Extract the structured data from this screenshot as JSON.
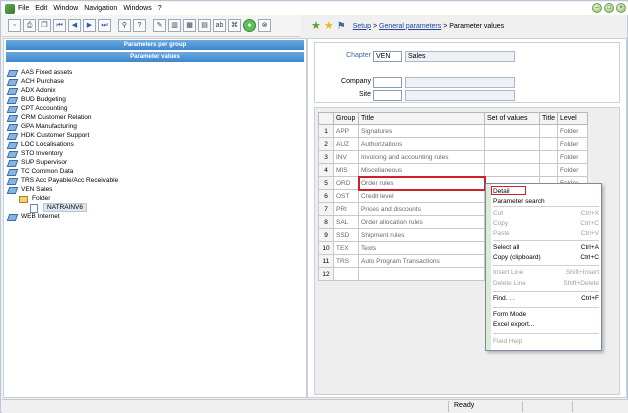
{
  "menubar": {
    "items": [
      "File",
      "Edit",
      "Window",
      "Navigation",
      "Windows",
      "?"
    ]
  },
  "toolbar": {
    "buttons": [
      "new-icon",
      "print-icon",
      "copy-icon",
      "first-icon",
      "prev-icon",
      "next-icon",
      "last-icon",
      "link-icon",
      "help-icon",
      "tree-icon",
      "split-icon",
      "grid-icon",
      "text-icon",
      "tool-icon",
      "go-icon",
      "stop-icon"
    ],
    "ab_label": "ab"
  },
  "left": {
    "header_group": "Parameters per group",
    "header_values": "Parameter values",
    "tree": [
      {
        "label": "AAS Fixed assets",
        "level": 0
      },
      {
        "label": "ACH Purchase",
        "level": 0
      },
      {
        "label": "ADX Adonix",
        "level": 0
      },
      {
        "label": "BUD Budgeting",
        "level": 0
      },
      {
        "label": "CPT Accounting",
        "level": 0
      },
      {
        "label": "CRM Customer Relation",
        "level": 0
      },
      {
        "label": "GPA Manufacturing",
        "level": 0
      },
      {
        "label": "HDK Customer Support",
        "level": 0
      },
      {
        "label": "LOC Localisations",
        "level": 0
      },
      {
        "label": "STO Inventory",
        "level": 0
      },
      {
        "label": "SUP Supervisor",
        "level": 0
      },
      {
        "label": "TC Common Data",
        "level": 0
      },
      {
        "label": "TRS Acc Payable/Acc Receivable",
        "level": 0
      },
      {
        "label": "VEN Sales",
        "level": 0
      },
      {
        "label": "Folder",
        "level": 1
      },
      {
        "label": "NATRAINV6",
        "level": 2
      },
      {
        "label": "WEB Internet",
        "level": 0
      }
    ]
  },
  "breadcrumb": {
    "setup": "Setup",
    "sep1": " > ",
    "general": "General parameters",
    "sep2": " > ",
    "current": "Parameter values"
  },
  "form": {
    "chapter_label": "Chapter",
    "chapter_code": "VEN",
    "chapter_name": "Sales",
    "company_label": "Company",
    "company_value": "",
    "site_label": "Site",
    "site_value": ""
  },
  "grid": {
    "headers": [
      "",
      "Group",
      "Title",
      "Set of values",
      "Title",
      "Level"
    ],
    "rows": [
      {
        "n": "1",
        "group": "APP",
        "title": "Signatures",
        "set": "",
        "t2": "",
        "level": "Folder"
      },
      {
        "n": "2",
        "group": "AUZ",
        "title": "Authorizations",
        "set": "",
        "t2": "",
        "level": "Folder"
      },
      {
        "n": "3",
        "group": "INV",
        "title": "Invoicing and accounting rules",
        "set": "",
        "t2": "",
        "level": "Folder"
      },
      {
        "n": "4",
        "group": "MIS",
        "title": "Miscellaneous",
        "set": "",
        "t2": "",
        "level": "Folder"
      },
      {
        "n": "5",
        "group": "ORD",
        "title": "Order rules",
        "set": "",
        "t2": "",
        "level": "Folder"
      },
      {
        "n": "6",
        "group": "OST",
        "title": "Credit level",
        "set": "",
        "t2": "",
        "level": ""
      },
      {
        "n": "7",
        "group": "PRI",
        "title": "Prices and discounts",
        "set": "",
        "t2": "",
        "level": ""
      },
      {
        "n": "8",
        "group": "SAL",
        "title": "Order allocation rules",
        "set": "",
        "t2": "",
        "level": ""
      },
      {
        "n": "9",
        "group": "SSD",
        "title": "Shipment rules",
        "set": "",
        "t2": "",
        "level": ""
      },
      {
        "n": "10",
        "group": "TEX",
        "title": "Texts",
        "set": "",
        "t2": "",
        "level": ""
      },
      {
        "n": "11",
        "group": "TRS",
        "title": "Auto Program Transactions",
        "set": "",
        "t2": "",
        "level": ""
      },
      {
        "n": "12",
        "group": "",
        "title": "",
        "set": "",
        "t2": "",
        "level": ""
      }
    ]
  },
  "context_menu": {
    "items": [
      {
        "label": "Detail",
        "shortcut": "",
        "disabled": false
      },
      {
        "label": "Parameter search",
        "shortcut": "",
        "disabled": false
      },
      {
        "label": "Cut",
        "shortcut": "Ctrl+X",
        "disabled": true
      },
      {
        "label": "Copy",
        "shortcut": "Ctrl+C",
        "disabled": true
      },
      {
        "label": "Paste",
        "shortcut": "Ctrl+V",
        "disabled": true
      },
      {
        "label": "Select all",
        "shortcut": "Ctrl+A",
        "disabled": false
      },
      {
        "label": "Copy (clipboard)",
        "shortcut": "Ctrl+C",
        "disabled": false
      },
      {
        "label": "Insert Line",
        "shortcut": "Shift+Insert",
        "disabled": true
      },
      {
        "label": "Delete Line",
        "shortcut": "Shift+Delete",
        "disabled": true
      },
      {
        "label": "Find. . .",
        "shortcut": "Ctrl+F",
        "disabled": false
      },
      {
        "label": "Form Mode",
        "shortcut": "",
        "disabled": false
      },
      {
        "label": "Excel export...",
        "shortcut": "",
        "disabled": false
      },
      {
        "label": "Field Help",
        "shortcut": "",
        "disabled": true
      }
    ]
  },
  "status": {
    "text": "Ready"
  }
}
